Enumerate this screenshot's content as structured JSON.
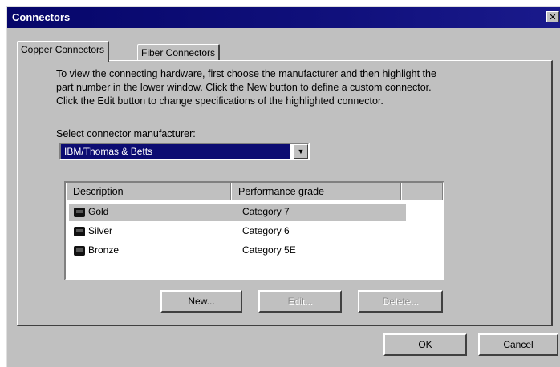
{
  "window": {
    "title": "Connectors",
    "close_glyph": "✕"
  },
  "tabs": [
    {
      "label": "Copper Connectors",
      "active": true
    },
    {
      "label": "Fiber Connectors",
      "active": false
    }
  ],
  "instructions": "To view the connecting  hardware, first choose the manufacturer and then highlight the\npart number in the lower window.  Click the New button to define a custom connector.\nClick the Edit button to change specifications of the highlighted connector.",
  "manufacturer": {
    "label": "Select connector manufacturer:",
    "value": "IBM/Thomas & Betts"
  },
  "list": {
    "columns": [
      "Description",
      "Performance grade"
    ],
    "rows": [
      {
        "description": "Gold",
        "grade": "Category 7",
        "selected": true,
        "icon": "connector-icon"
      },
      {
        "description": "Silver",
        "grade": "Category 6",
        "selected": false,
        "icon": "connector-icon"
      },
      {
        "description": "Bronze",
        "grade": "Category 5E",
        "selected": false,
        "icon": "connector-icon"
      }
    ]
  },
  "buttons": {
    "new": "New...",
    "edit": "Edit...",
    "delete": "Delete...",
    "ok": "OK",
    "cancel": "Cancel"
  },
  "colors": {
    "titlebar": "#0c0c72",
    "face": "#c0c0c0",
    "selection": "#0c0c72"
  }
}
